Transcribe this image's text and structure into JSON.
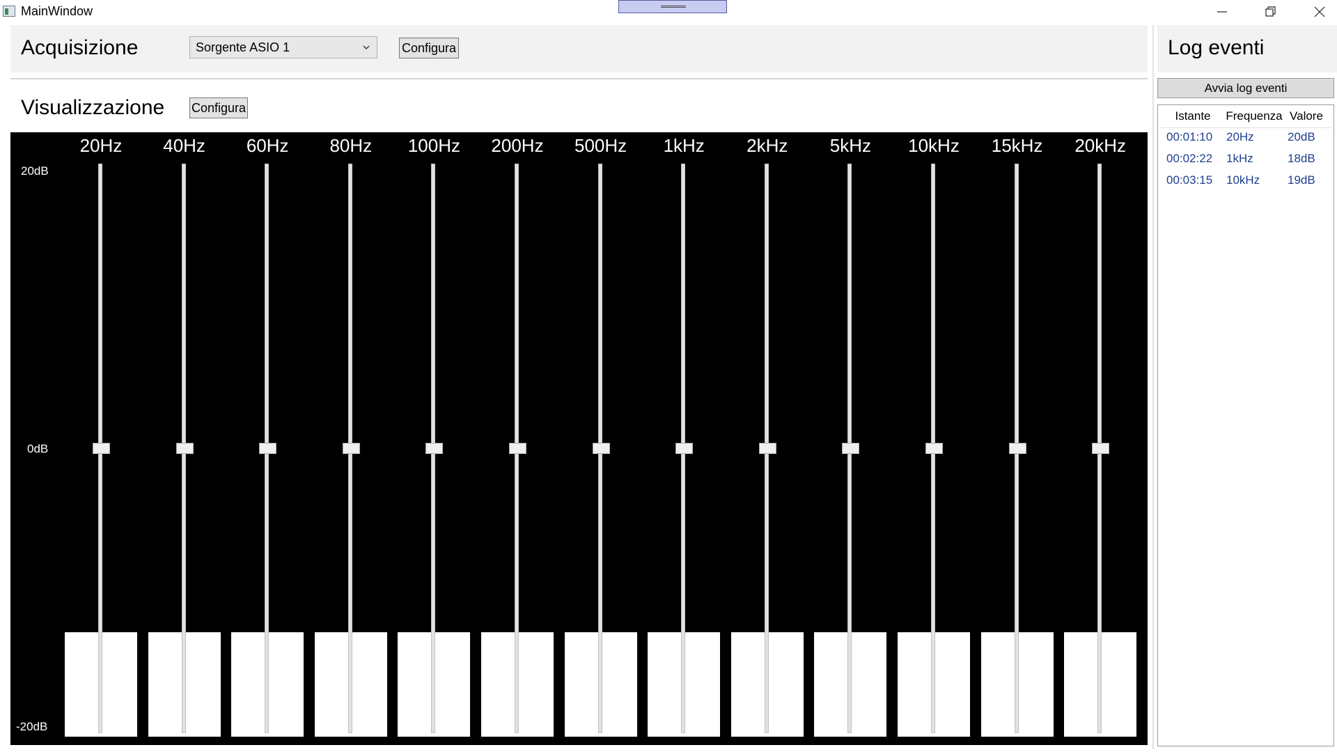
{
  "window": {
    "title": "MainWindow"
  },
  "acquisizione": {
    "title": "Acquisizione",
    "source": "Sorgente ASIO 1",
    "configure_label": "Configura"
  },
  "visualizzazione": {
    "title": "Visualizzazione",
    "configure_label": "Configura"
  },
  "equalizer": {
    "db_labels": {
      "top": "20dB",
      "mid": "0dB",
      "bottom": "-20dB"
    },
    "bands": [
      {
        "freq": "20Hz",
        "gain_db": 0
      },
      {
        "freq": "40Hz",
        "gain_db": 0
      },
      {
        "freq": "60Hz",
        "gain_db": 0
      },
      {
        "freq": "80Hz",
        "gain_db": 0
      },
      {
        "freq": "100Hz",
        "gain_db": 0
      },
      {
        "freq": "200Hz",
        "gain_db": 0
      },
      {
        "freq": "500Hz",
        "gain_db": 0
      },
      {
        "freq": "1kHz",
        "gain_db": 0
      },
      {
        "freq": "2kHz",
        "gain_db": 0
      },
      {
        "freq": "5kHz",
        "gain_db": 0
      },
      {
        "freq": "10kHz",
        "gain_db": 0
      },
      {
        "freq": "15kHz",
        "gain_db": 0
      },
      {
        "freq": "20kHz",
        "gain_db": 0
      }
    ]
  },
  "log": {
    "title": "Log eventi",
    "start_label": "Avvia log eventi",
    "columns": [
      "Istante",
      "Frequenza",
      "Valore"
    ],
    "rows": [
      [
        "00:01:10",
        "20Hz",
        "20dB"
      ],
      [
        "00:02:22",
        "1kHz",
        "18dB"
      ],
      [
        "00:03:15",
        "10kHz",
        "19dB"
      ]
    ]
  }
}
